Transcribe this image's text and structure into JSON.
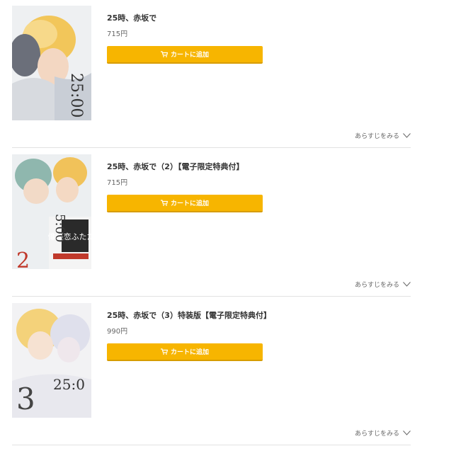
{
  "products": [
    {
      "title": "25時、赤坂で",
      "price": "715円",
      "cart_label": "カートに追加",
      "synopsis_label": "あらすじをみる",
      "cover_numeral": "25:00",
      "cover_volume": ""
    },
    {
      "title": "25時、赤坂で（2）【電子限定特典付】",
      "price": "715円",
      "cart_label": "カートに追加",
      "synopsis_label": "あらすじをみる",
      "cover_numeral": "5:00",
      "cover_volume": "2",
      "cover_banner": "俳優恋ふたたび"
    },
    {
      "title": "25時、赤坂で（3）特装版【電子限定特典付】",
      "price": "990円",
      "cart_label": "カートに追加",
      "synopsis_label": "あらすじをみる",
      "cover_numeral": "25:0",
      "cover_volume": "3"
    }
  ],
  "colors": {
    "button": "#f7b500",
    "button_shadow": "#d79c00",
    "divider": "#e2e2e2"
  },
  "icons": {
    "cart": "cart-icon",
    "chevron": "chevron-down-icon"
  }
}
